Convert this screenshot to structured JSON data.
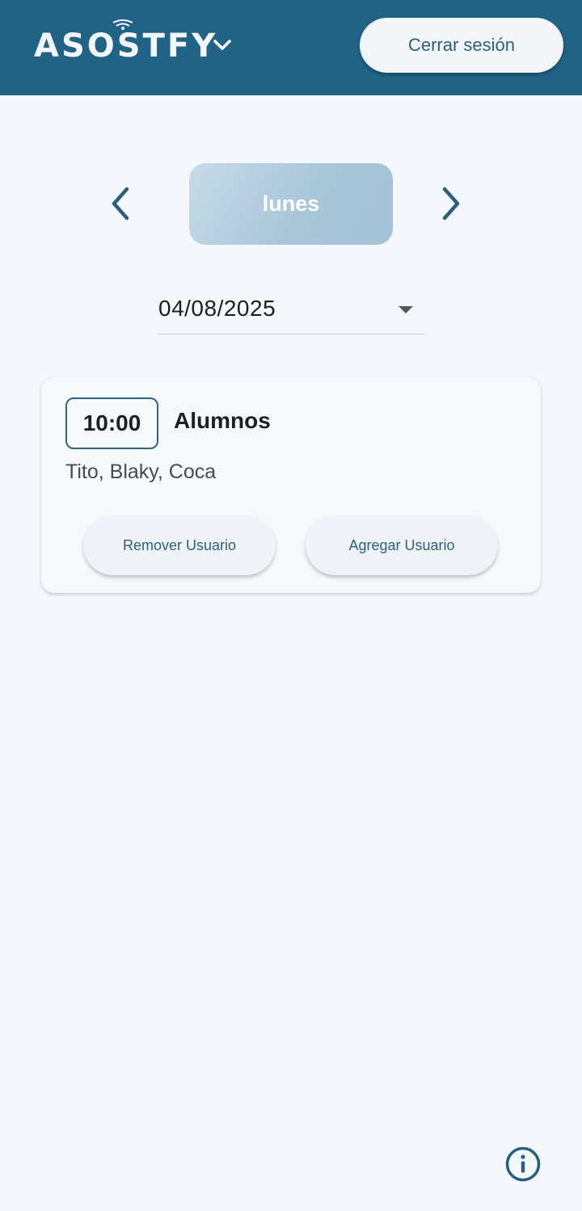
{
  "header": {
    "logo_text": "ASOSTFY",
    "logout_label": "Cerrar sesión",
    "background_color": "#216387"
  },
  "day_selector": {
    "day_label": "lunes"
  },
  "date_picker": {
    "value": "04/08/2025"
  },
  "session_card": {
    "time": "10:00",
    "group": "Alumnos",
    "members": "Tito, Blaky, Coca",
    "remove_label": "Remover Usuario",
    "add_label": "Agregar Usuario"
  },
  "icons": {
    "menu": "chevron-down-icon",
    "prev": "chevron-left-icon",
    "next": "chevron-right-icon",
    "info": "info-icon"
  }
}
